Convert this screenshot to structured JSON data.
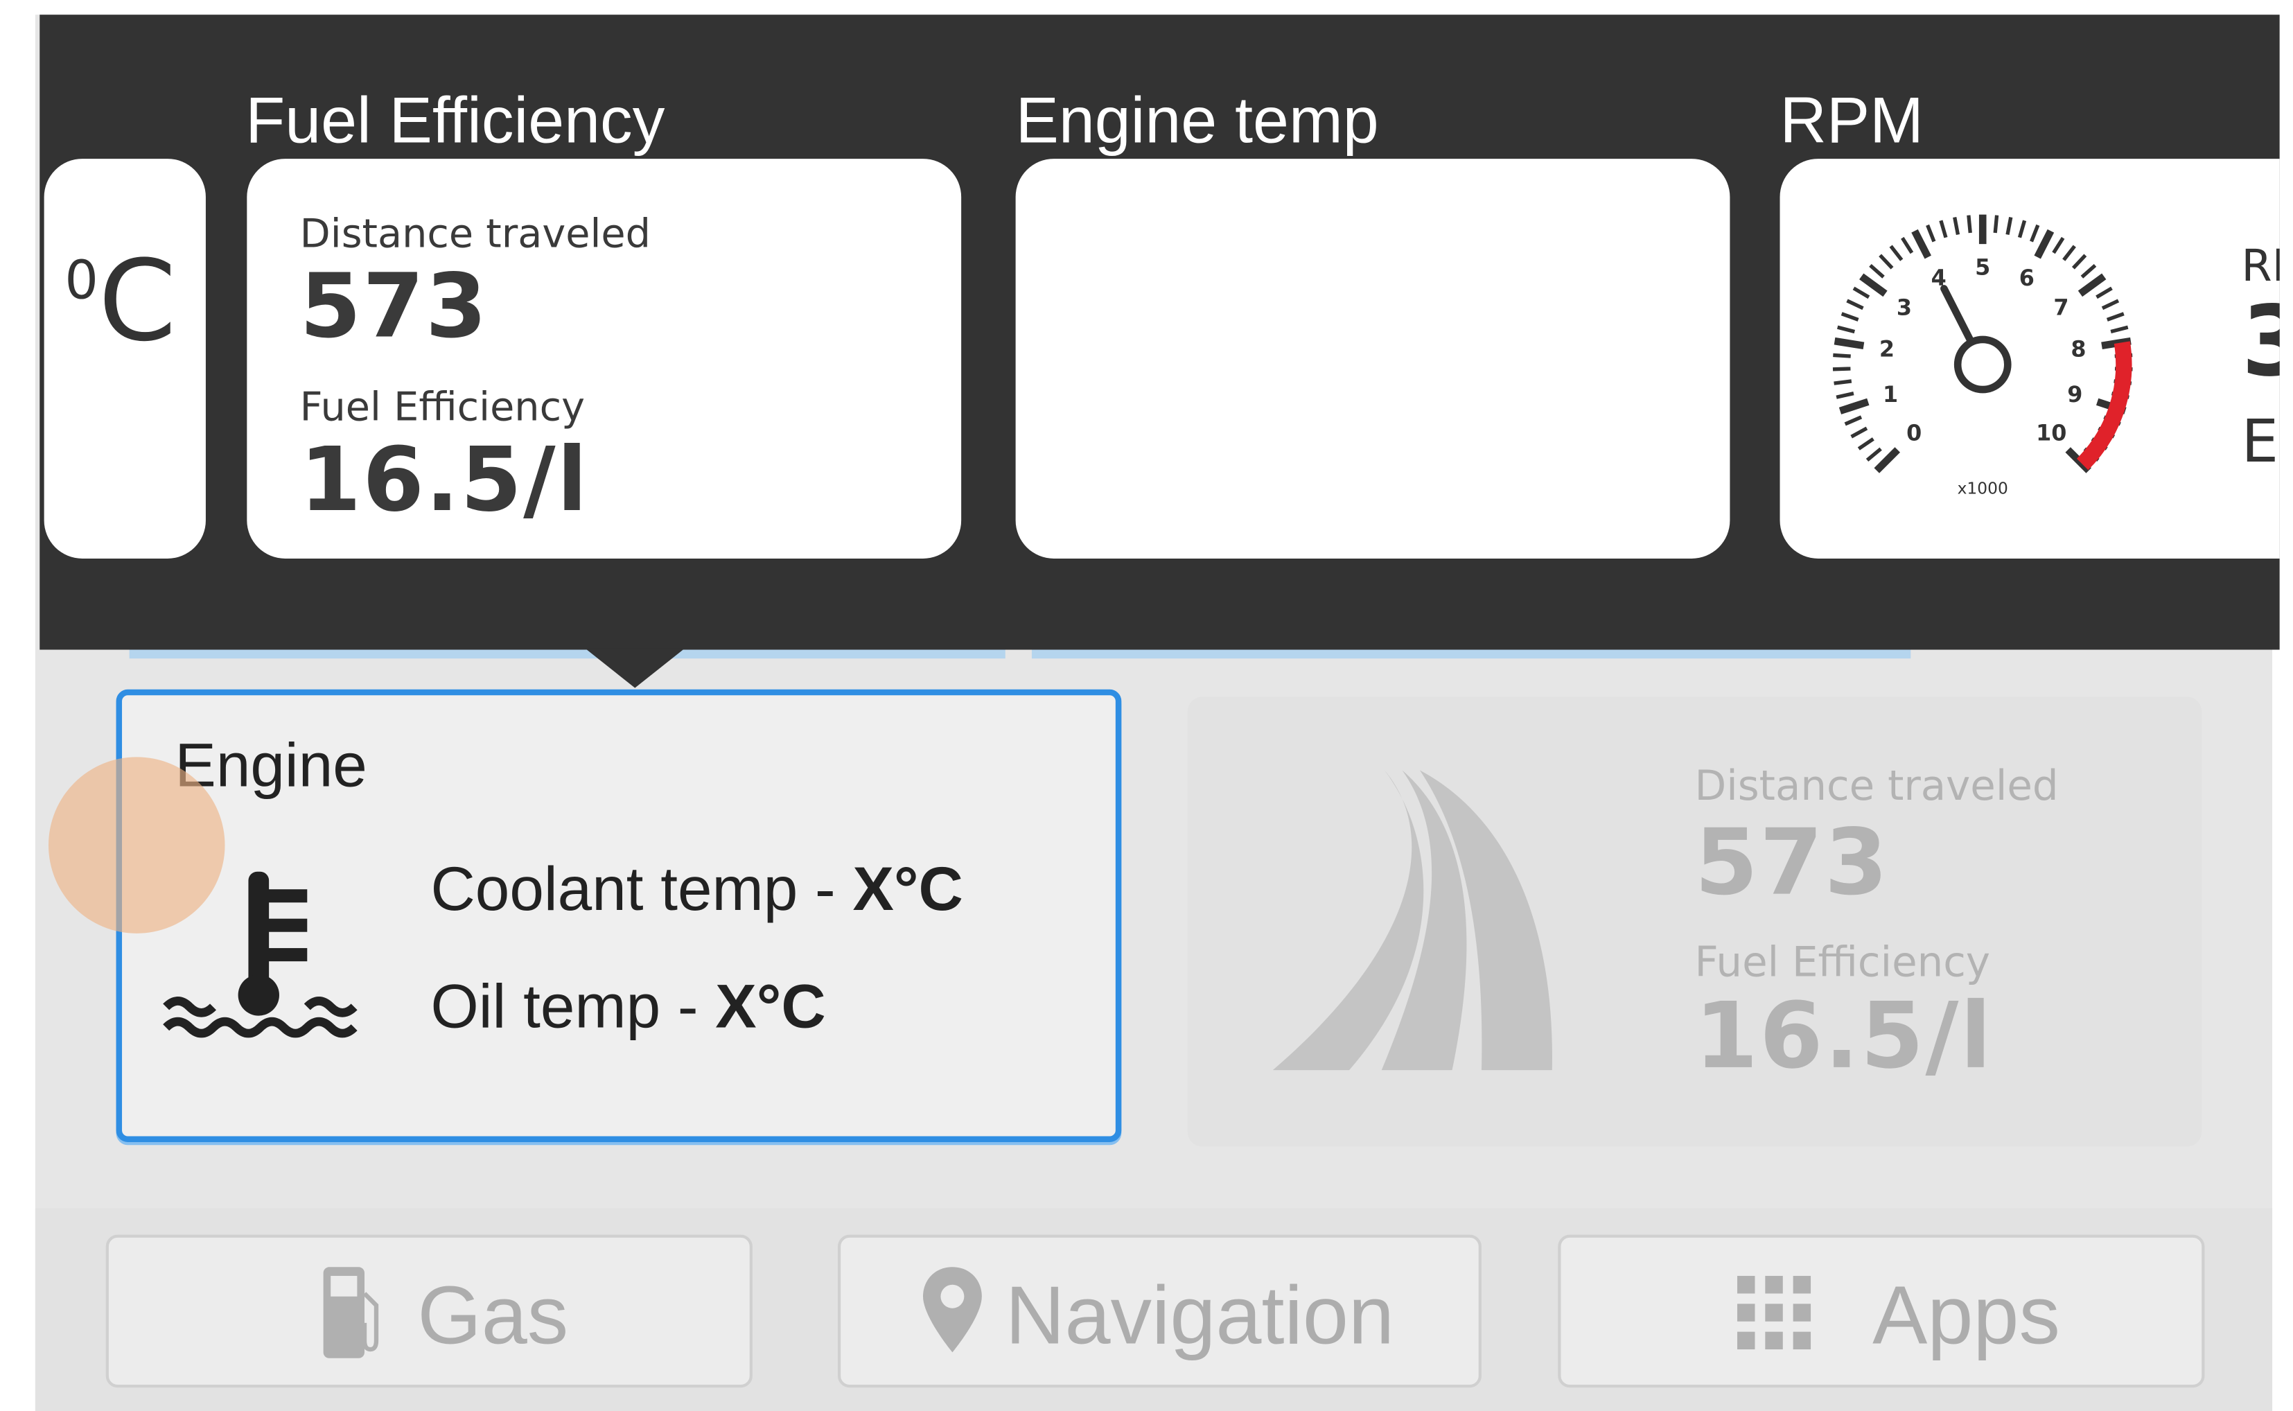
{
  "overlay": {
    "partial_left_unit": "0C",
    "fuel_efficiency_title": "Fuel Efficiency",
    "engine_temp_title": "Engine temp",
    "rpm_title": "RPM",
    "fuel_card": {
      "distance_label": "Distance traveled",
      "distance_value": "573",
      "efficiency_label": "Fuel Efficiency",
      "efficiency_value": "16.5/l"
    },
    "rpm_gauge": {
      "numbers": [
        "0",
        "1",
        "2",
        "3",
        "4",
        "5",
        "6",
        "7",
        "8",
        "9",
        "10"
      ],
      "multiplier": "x1000",
      "needle_value": 4,
      "redline_start": 8
    },
    "partial_right": {
      "line1": "RI",
      "line2": "3",
      "line3": "E"
    }
  },
  "engine_card": {
    "title": "Engine",
    "coolant_label": "Coolant temp - ",
    "coolant_value": "X°C",
    "oil_label": "Oil temp - ",
    "oil_value": "X°C"
  },
  "distance_card": {
    "distance_label": "Distance traveled",
    "distance_value": "573",
    "efficiency_label": "Fuel Efficiency",
    "efficiency_value": "16.5/l"
  },
  "bottom_nav": {
    "gas": "Gas",
    "navigation": "Navigation",
    "apps": "Apps"
  },
  "colors": {
    "overlay": "#333333",
    "accent_blue": "#2f8ee3",
    "redline": "#e0222a",
    "touch_indicator": "#eeb183"
  },
  "icons": [
    "coolant-temperature-icon",
    "road-icon",
    "gas-pump-icon",
    "map-pin-icon",
    "apps-grid-icon"
  ]
}
